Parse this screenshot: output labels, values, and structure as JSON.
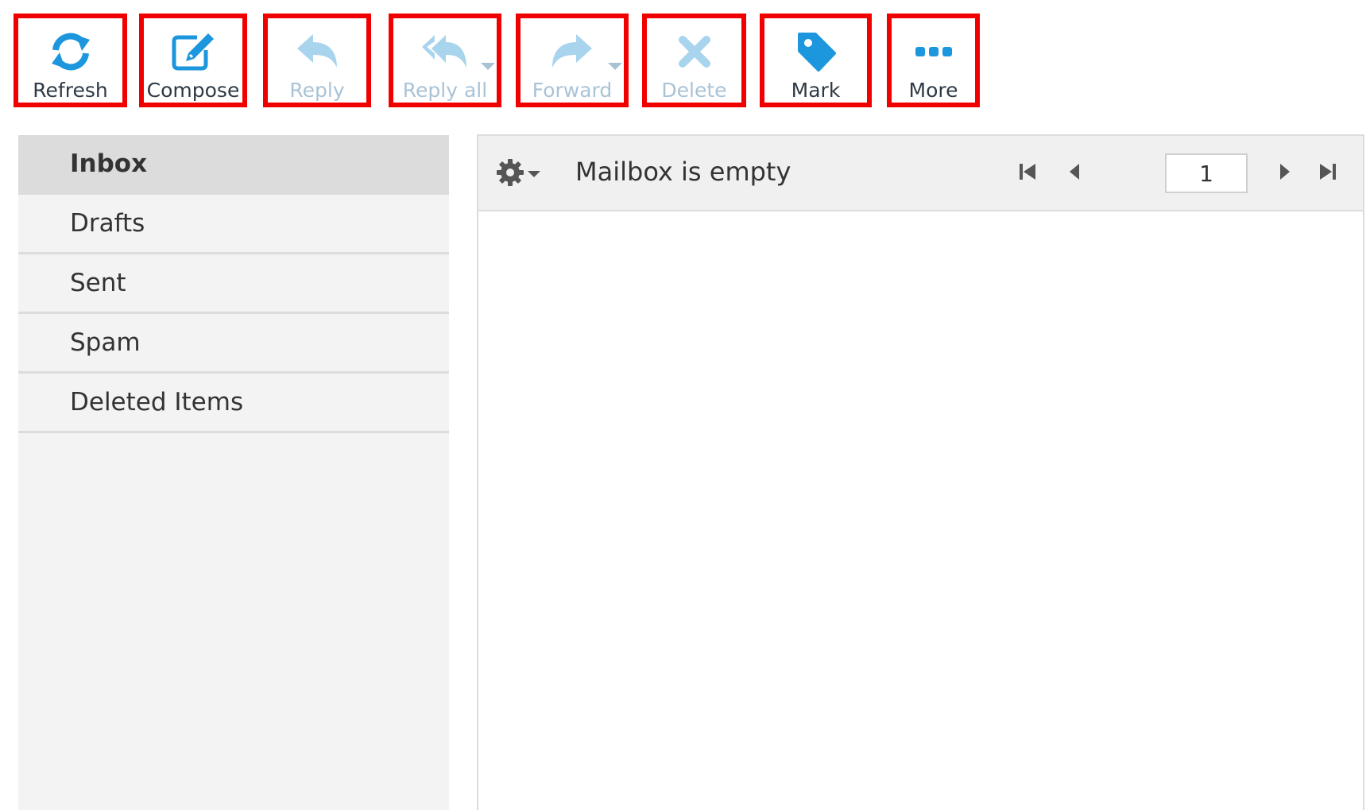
{
  "toolbar": {
    "buttons": [
      {
        "id": "refresh",
        "label": "Refresh",
        "icon": "refresh-icon",
        "enabled": true
      },
      {
        "id": "compose",
        "label": "Compose",
        "icon": "compose-icon",
        "enabled": true
      },
      {
        "id": "reply",
        "label": "Reply",
        "icon": "reply-icon",
        "enabled": false
      },
      {
        "id": "reply-all",
        "label": "Reply all",
        "icon": "reply-all-icon",
        "enabled": false
      },
      {
        "id": "forward",
        "label": "Forward",
        "icon": "forward-icon",
        "enabled": false
      },
      {
        "id": "delete",
        "label": "Delete",
        "icon": "delete-icon",
        "enabled": false
      },
      {
        "id": "mark",
        "label": "Mark",
        "icon": "tag-icon",
        "enabled": true
      },
      {
        "id": "more",
        "label": "More",
        "icon": "more-icon",
        "enabled": true
      }
    ]
  },
  "sidebar": {
    "folders": [
      {
        "label": "Inbox",
        "active": true
      },
      {
        "label": "Drafts",
        "active": false
      },
      {
        "label": "Sent",
        "active": false
      },
      {
        "label": "Spam",
        "active": false
      },
      {
        "label": "Deleted Items",
        "active": false
      }
    ]
  },
  "mail_list": {
    "status": "Mailbox is empty",
    "page_value": "1",
    "icons": {
      "settings": "gear-icon",
      "first": "first-page-icon",
      "prev": "prev-page-icon",
      "next": "next-page-icon",
      "last": "last-page-icon"
    }
  },
  "colors": {
    "accent": "#1c96dd",
    "disabled": "#a9c3d6",
    "highlight_border": "#f10000",
    "sidebar_bg": "#f3f3f3",
    "active_folder_bg": "#dcdcdc"
  }
}
